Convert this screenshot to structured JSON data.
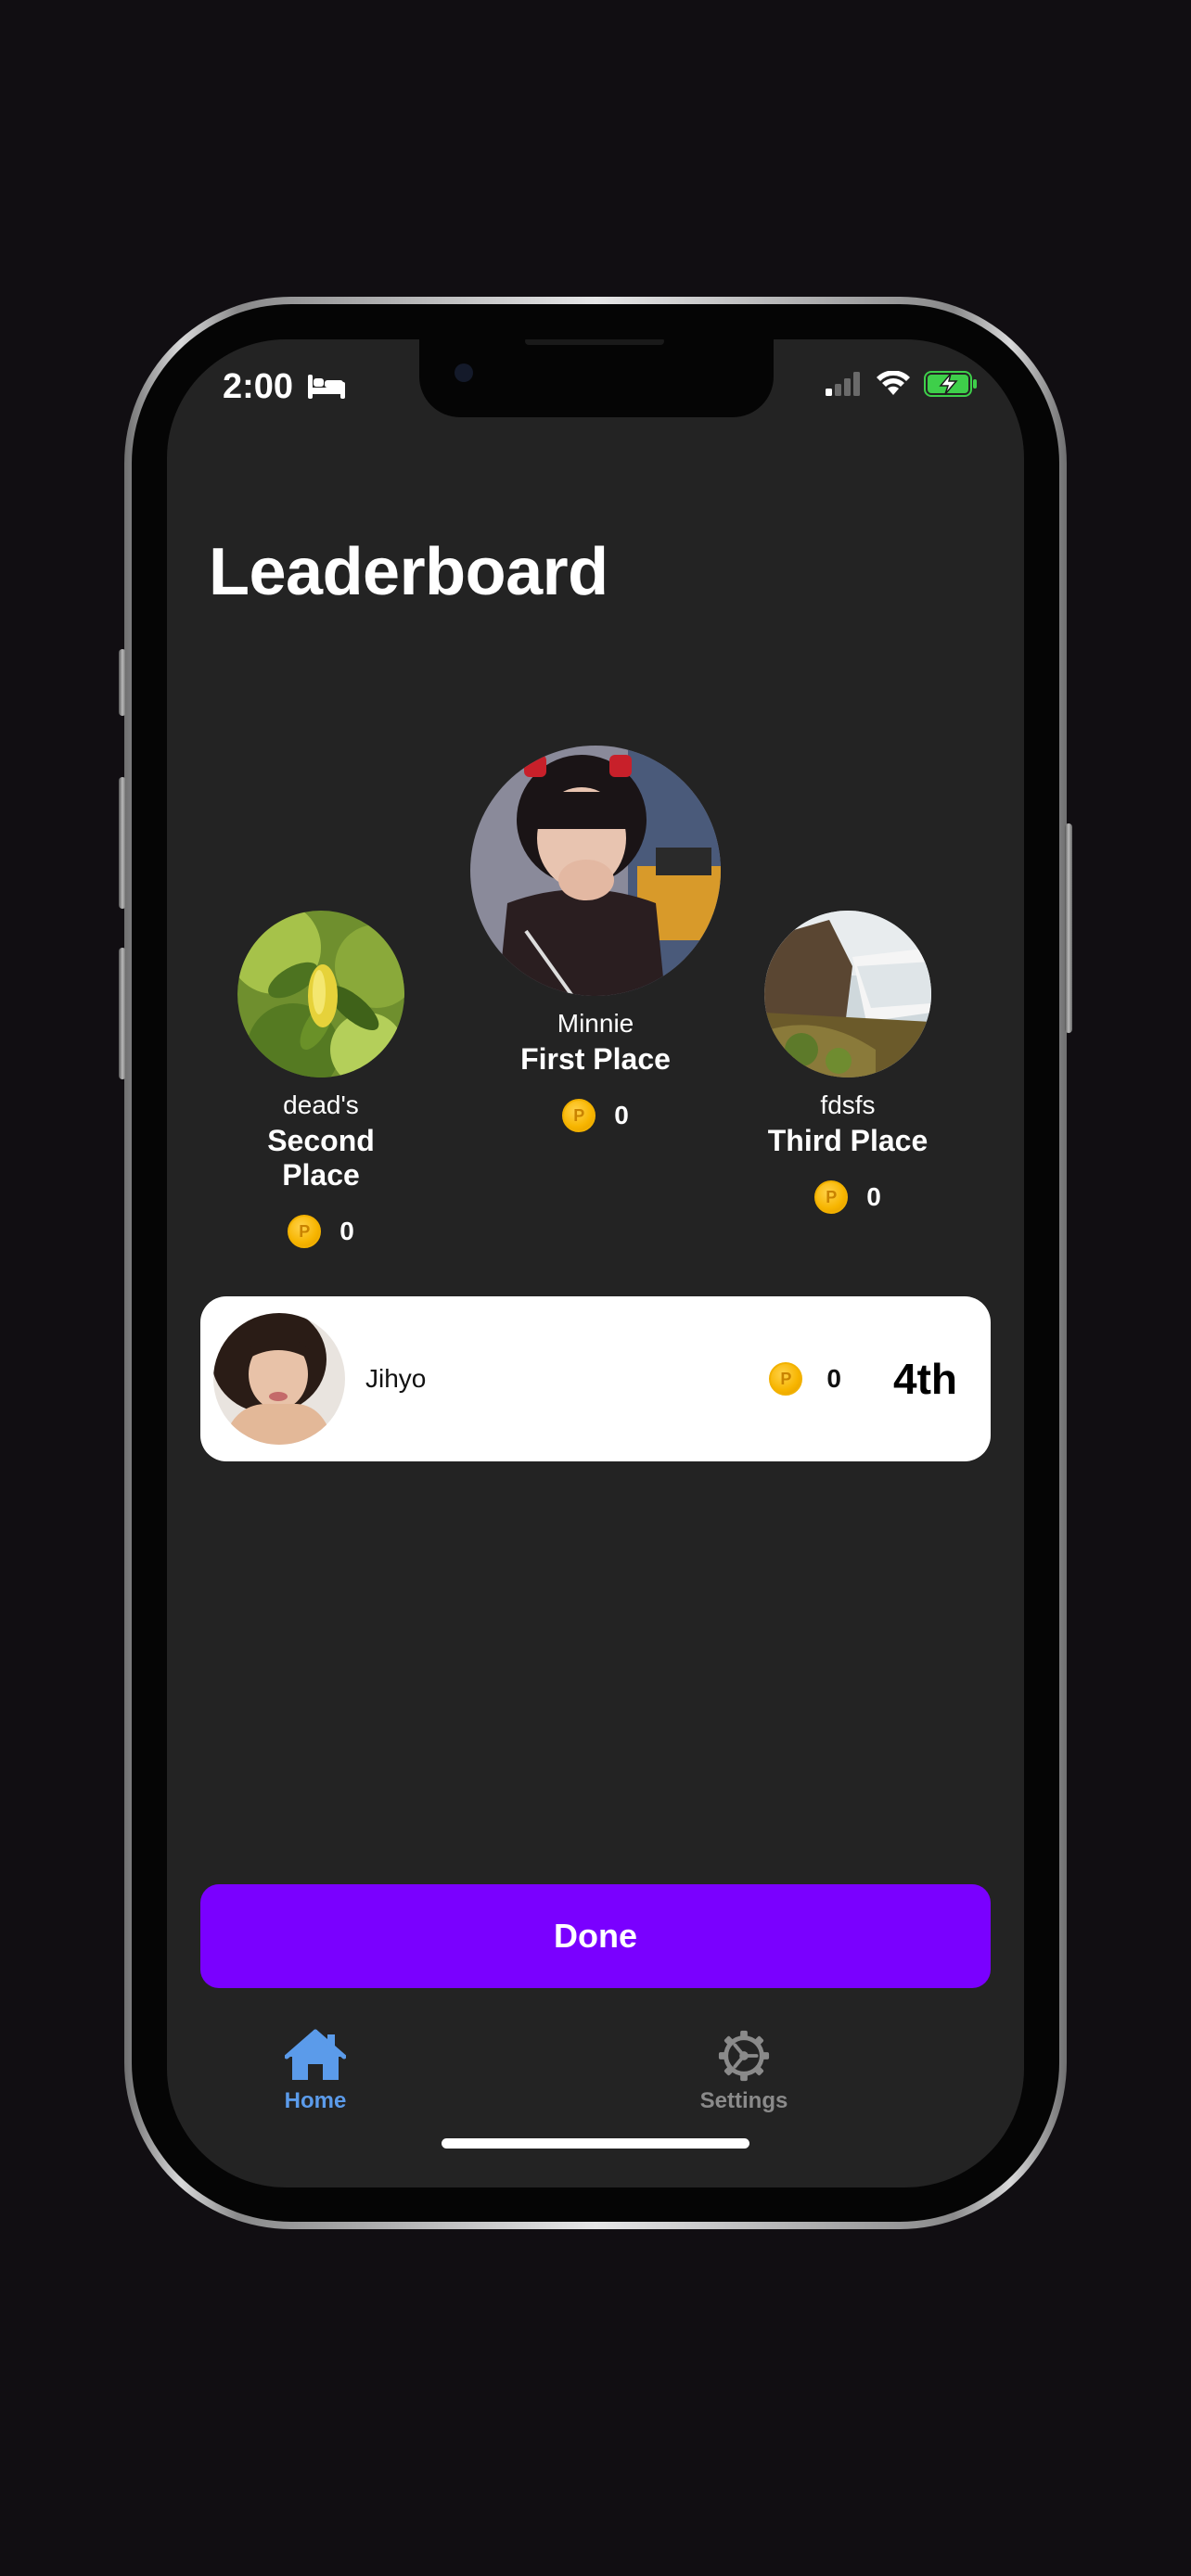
{
  "status_bar": {
    "time": "2:00"
  },
  "header": {
    "title": "Leaderboard"
  },
  "podium": {
    "first": {
      "name": "Minnie",
      "place": "First Place",
      "points": "0"
    },
    "second": {
      "name": "dead's",
      "place": "Second Place",
      "points": "0"
    },
    "third": {
      "name": "fdsfs",
      "place": "Third Place",
      "points": "0"
    }
  },
  "rankings": [
    {
      "name": "Jihyo",
      "points": "0",
      "rank": "4th"
    }
  ],
  "actions": {
    "done_label": "Done"
  },
  "tab_bar": {
    "items": [
      {
        "label": "Home",
        "icon": "home-icon",
        "active": true
      },
      {
        "label": "Settings",
        "icon": "gear-icon",
        "active": false
      }
    ]
  },
  "colors": {
    "accent": "#7a00ff",
    "active_tab": "#5b9bea",
    "inactive_tab": "#8a8a8a",
    "coin": "#f7b500"
  }
}
